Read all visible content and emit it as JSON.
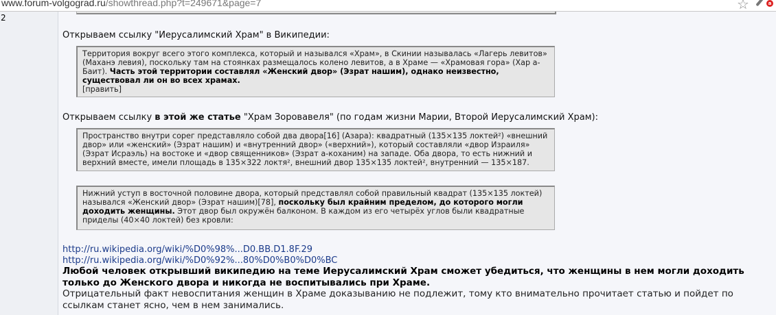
{
  "browser": {
    "url_host": "www.forum-volgograd.ru",
    "url_path": "/showthread.php?t=249671&page=7",
    "badge": "a"
  },
  "post": {
    "number": "2",
    "intro1": "Открываем ссылку \"Иерусалимский Храм\" в Википедии:",
    "quote1": {
      "text_plain": "Территория вокруг всего этого комплекса, который и назывался «Храм», в Скинии называлась «Лагерь левитов» (Маханэ левия), поскольку там на стоянках размещалось колено левитов, а в Храме — «Храмовая гора» (Хар а-Баит). ",
      "text_bold": "Часть этой территории составлял «Женский двор» (Эзрат нашим), однако неизвестно, существовал ли он во всех храмах.",
      "edit": "[править]"
    },
    "intro2_pre": "Открываем ссылку ",
    "intro2_bold": "в этой же статье",
    "intro2_post": " \"Храм Зоровавеля\" (по годам жизни Марии, Второй Иерусалимский Храм):",
    "quote2": "Пространство внутри сорег представляло собой два двора[16] (Азара): квадратный (135×135 локтей²) «внешний двор» или «женский» (Эзрат нашим) и «внутренний двор» («верхний»), который составляли «двор Израиля» (Эзрат Исраэль) на востоке и «двор священников» (Эзрат а-коханим) на западе. Оба двора, то есть нижний и верхний вместе, имели площадь в 135×322 локтя², внешний двор 135×135 локтей², внутренний — 135×187.",
    "quote3": {
      "text_plain": "Нижний уступ в восточной половине двора, который представлял собой правильный квадрат (135×135 локтей) назывался «Женский двор» (Эзрат нашим)[78], ",
      "text_bold": "поскольку был крайним пределом, до которого могли доходить женщины.",
      "text_tail": " Этот двор был окружён балконом. В каждом из его четырёх углов были квадратные приделы (40×40 локтей) без кровли:"
    },
    "link1": "http://ru.wikipedia.org/wiki/%D0%98%...D0.BB.D1.8F.29",
    "link2": "http://ru.wikipedia.org/wiki/%D0%92%...80%D0%B0%D0%BC",
    "conclusion_bold": "Любой человек открывший википедию на теме Иерусалимский Храм сможет убедиться, что женщины в нем могли доходить только до Женского двора и никогда не воспитывались при Храме.",
    "conclusion": "Отрицательный факт невоспитания женщин в Храме доказыванию не подлежит, тому кто внимательно прочитает статью и пойдет по ссылкам станет ясно, чем в нем занимались."
  }
}
